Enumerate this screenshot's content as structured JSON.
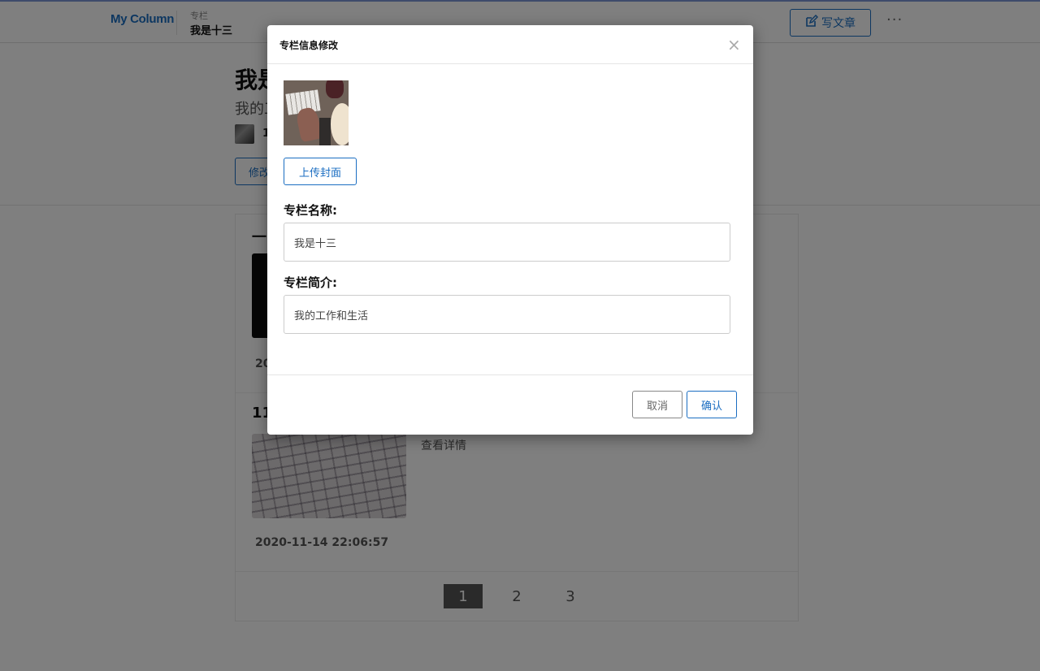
{
  "header": {
    "logo": "My Column",
    "breadcrumb_sub": "专栏",
    "breadcrumb_title": "我是十三",
    "write_label": "写文章",
    "more_label": "···"
  },
  "hero": {
    "title": "我是十三",
    "description": "我的工作和生活",
    "count": "1",
    "edit_label": "修改"
  },
  "articles": [
    {
      "title": "一",
      "link": "",
      "date": "20"
    },
    {
      "title": "11",
      "link": "查看详情",
      "date": "2020-11-14 22:06:57"
    }
  ],
  "pagination": {
    "pages": [
      "1",
      "2",
      "3"
    ],
    "active": "1"
  },
  "modal": {
    "title": "专栏信息修改",
    "close": "×",
    "upload_label": "上传封面",
    "name_label": "专栏名称:",
    "name_value": "我是十三",
    "desc_label": "专栏简介:",
    "desc_value": "我的工作和生活",
    "cancel_label": "取消",
    "ok_label": "确认"
  },
  "colors": {
    "accent": "#1b6ec2",
    "overlay": "rgba(0,0,0,0.5)"
  }
}
